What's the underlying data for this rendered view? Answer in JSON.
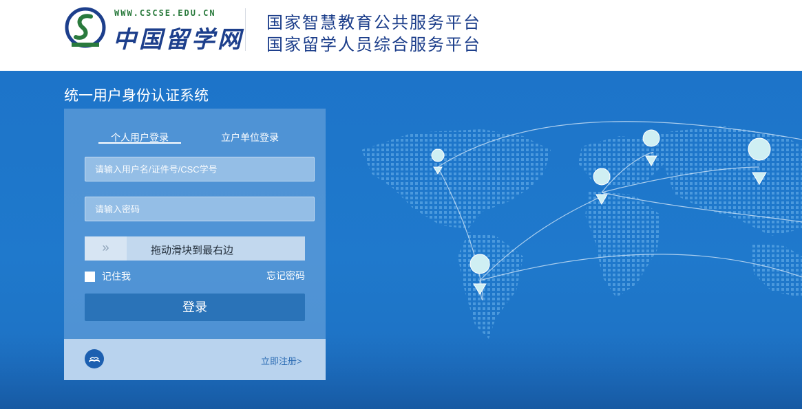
{
  "header": {
    "logo_url_text": "WWW.CSCSE.EDU.CN",
    "logo_name": "中国留学网",
    "platform_line1": "国家智慧教育公共服务平台",
    "platform_line2": "国家留学人员综合服务平台"
  },
  "login": {
    "system_title": "统一用户身份认证系统",
    "tabs": [
      {
        "label": "个人用户登录",
        "active": true
      },
      {
        "label": "立户单位登录",
        "active": false
      }
    ],
    "username_placeholder": "请输入用户名/证件号/CSC学号",
    "password_placeholder": "请输入密码",
    "slider_handle": "»",
    "slider_text": "拖动滑块到最右边",
    "remember_label": "记住我",
    "forgot_label": "忘记密码",
    "submit_label": "登录",
    "register_label": "立即注册>"
  },
  "colors": {
    "hero_blue": "#1d74c9",
    "brand_navy": "#1b3d8a",
    "brand_green": "#2a7a3d",
    "button_blue": "#2a73b8"
  }
}
